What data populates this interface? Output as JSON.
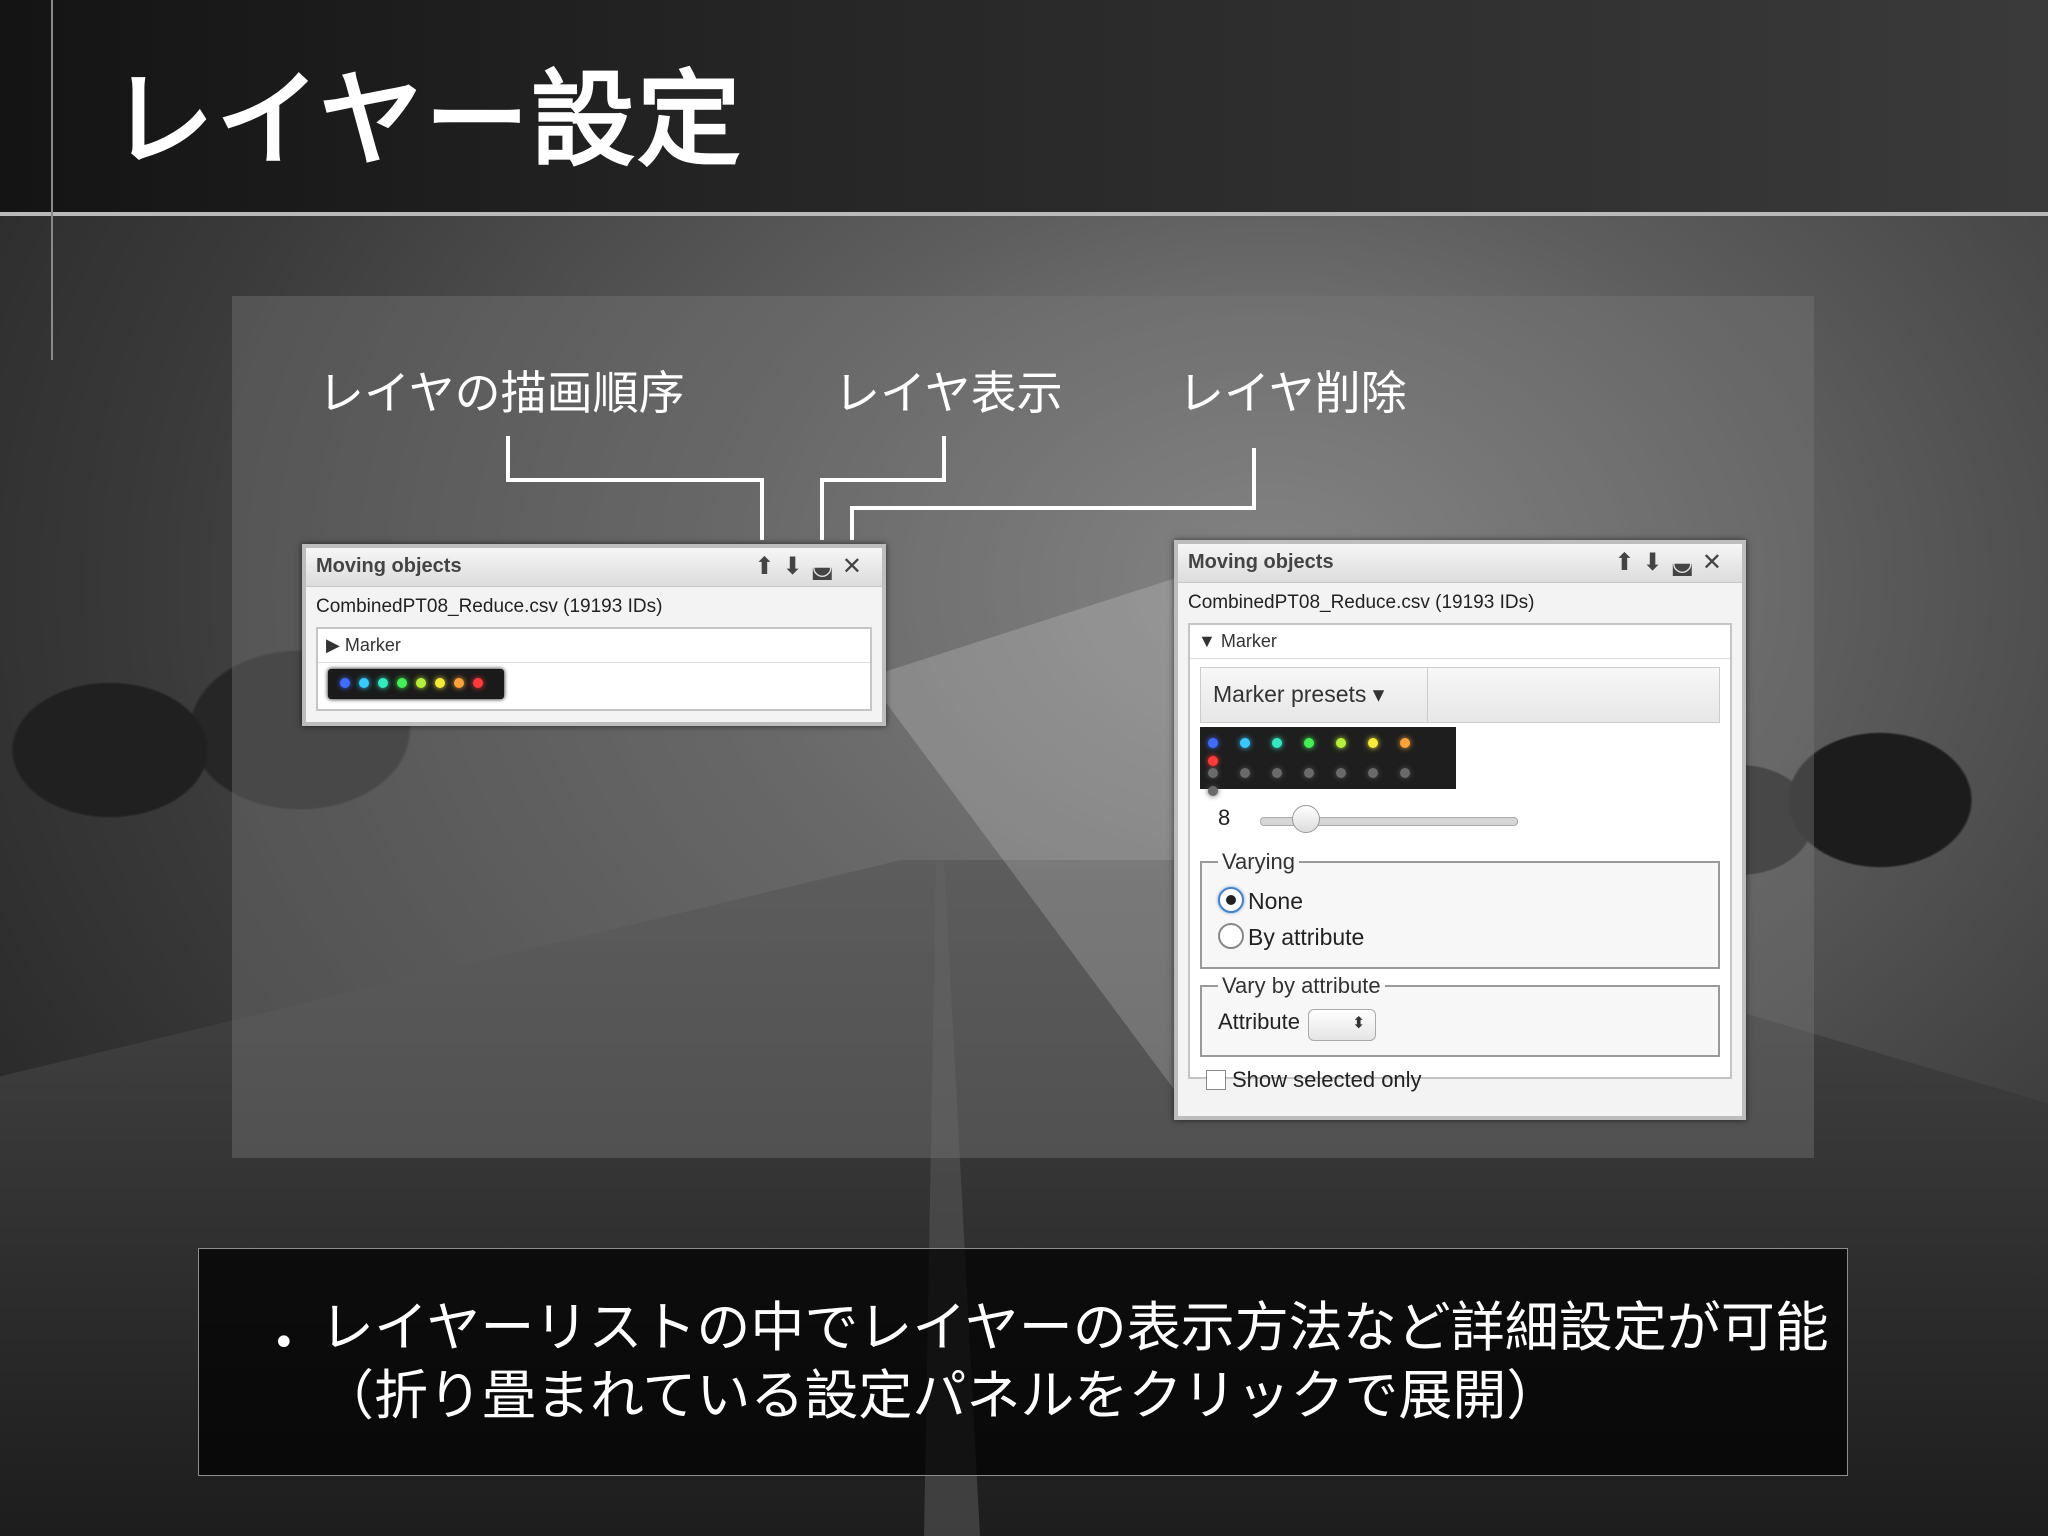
{
  "slide": {
    "title": "レイヤー設定",
    "bullet": "レイヤーリストの中でレイヤーの表示方法など詳細設定が可能（折り畳まれている設定パネルをクリックで展開）"
  },
  "callouts": {
    "order": "レイヤの描画順序",
    "visibility": "レイヤ表示",
    "delete": "レイヤ削除"
  },
  "window": {
    "title": "Moving objects",
    "file": "CombinedPT08_Reduce.csv (19193 IDs)",
    "section": "Marker",
    "icons": [
      "arrow-up-icon",
      "arrow-down-icon",
      "eye-icon",
      "close-icon"
    ]
  },
  "marker_panel": {
    "presets_label": "Marker presets",
    "size_value": "8",
    "varying_legend": "Varying",
    "option_none": "None",
    "option_by_attribute": "By attribute",
    "selected_option": "None",
    "vary_legend": "Vary by attribute",
    "attribute_label": "Attribute",
    "show_selected": "Show selected only"
  },
  "colors": {
    "marker_dots": [
      "#3f6dff",
      "#39c8ff",
      "#34e8c0",
      "#45ee55",
      "#b7f03c",
      "#f5e93a",
      "#ffa23a",
      "#ff3a3a"
    ],
    "marker_dots_muted": "#6a6a6a"
  }
}
